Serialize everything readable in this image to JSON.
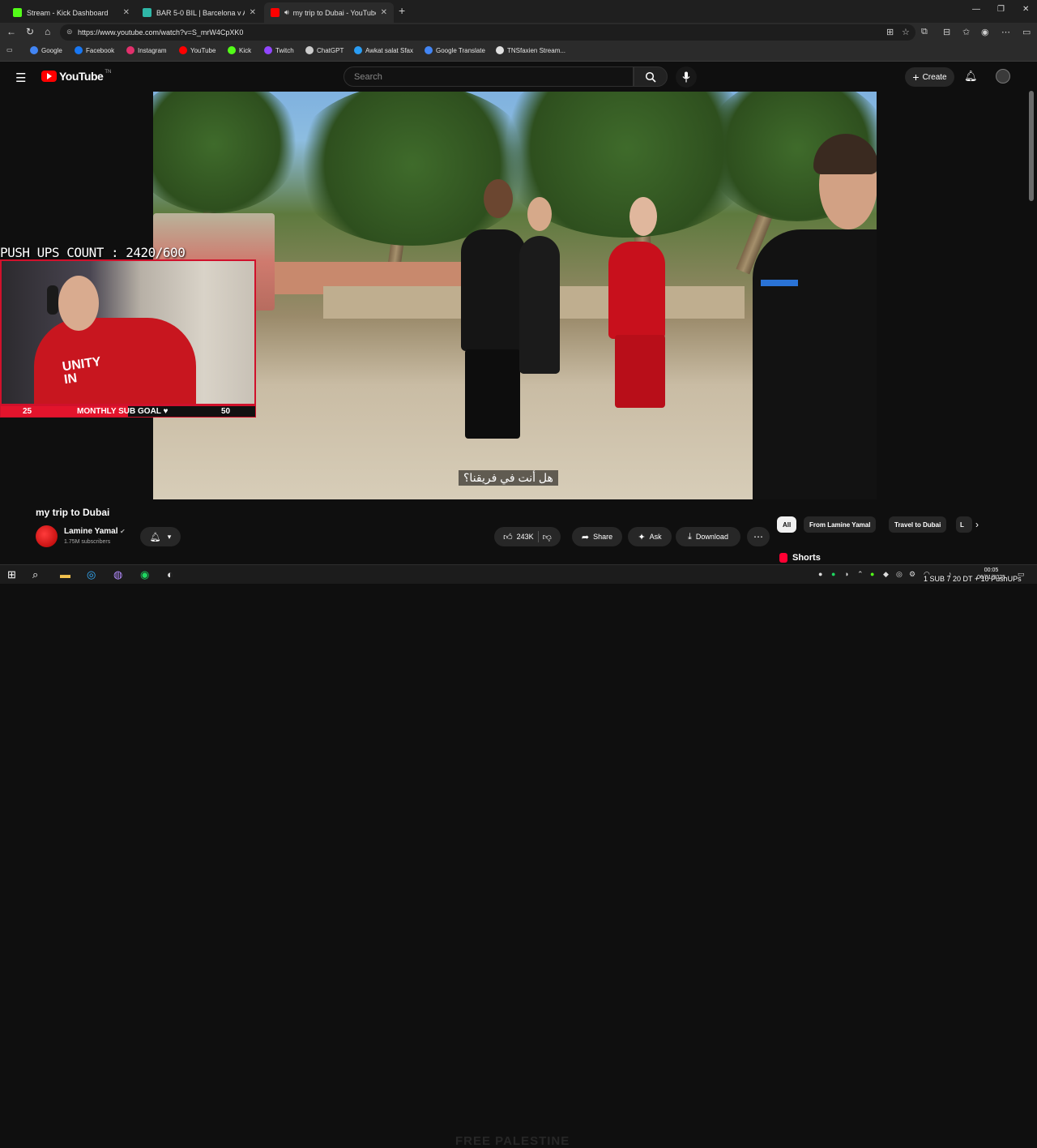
{
  "browser": {
    "tabs": [
      {
        "title": "Stream - Kick Dashboard",
        "favicon_color": "#53fc18"
      },
      {
        "title": "BAR 5-0 BIL | Barcelona v Ath Bilb",
        "favicon_color": "#2fb7a7"
      },
      {
        "title": "my trip to Dubai - YouTube",
        "favicon_color": "#ff0000"
      }
    ],
    "url": "https://www.youtube.com/watch?v=S_mrW4CpXK0",
    "bookmarks": [
      {
        "label": "Google",
        "color": "#4285f4"
      },
      {
        "label": "Facebook",
        "color": "#1877f2"
      },
      {
        "label": "Instagram",
        "color": "#e1306c"
      },
      {
        "label": "YouTube",
        "color": "#ff0000"
      },
      {
        "label": "Kick",
        "color": "#53fc18"
      },
      {
        "label": "Twitch",
        "color": "#9146ff"
      },
      {
        "label": "ChatGPT",
        "color": "#cccccc"
      },
      {
        "label": "Awkat salat Sfax",
        "color": "#2a9df4"
      },
      {
        "label": "Google Translate",
        "color": "#4285f4"
      },
      {
        "label": "TNSfaxien Stream...",
        "color": "#e0e0e0"
      }
    ]
  },
  "youtube": {
    "logo": "YouTube",
    "logo_tm": "TN",
    "search_placeholder": "Search",
    "create_label": "Create",
    "video": {
      "title": "my trip to Dubai",
      "subtitle": "هل أنت في فريقنا؟",
      "channel": "Lamine Yamal",
      "subscribers": "1.75M subscribers",
      "likes": "243K"
    },
    "actions": {
      "share": "Share",
      "ask": "Ask",
      "download": "Download"
    },
    "chips": [
      "All",
      "From Lamine Yamal",
      "Travel to Dubai",
      "L"
    ],
    "shorts_label": "Shorts"
  },
  "overlay": {
    "pushups": "PUSH UPS COUNT : 2420/600",
    "sub_goal_current": "25",
    "sub_goal_label": "MONTHLY SUB GOAL ♥",
    "sub_goal_target": "50",
    "sub_goal_fraction": 0.5,
    "watermark": "FREE PALESTINE",
    "ticker": "1 SUB 7 20 DT + 10 PushUPs"
  },
  "taskbar": {
    "time": "00:05",
    "date": "06/01/2025"
  },
  "colors": {
    "accent_red": "#ff0000",
    "overlay_red": "#e3142c",
    "background": "#0f0f0f"
  }
}
